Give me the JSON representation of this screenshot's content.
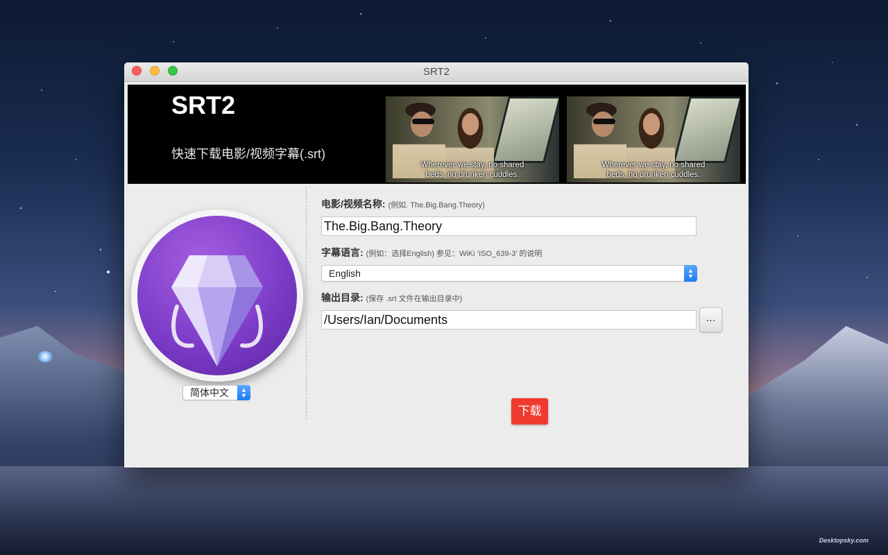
{
  "window": {
    "title": "SRT2"
  },
  "banner": {
    "title": "SRT2",
    "subtitle": "快速下载电影/视频字幕(.srt)",
    "sample_subtitle_line1": "Wherever we stay, no shared",
    "sample_subtitle_line2": "beds, no drunken cuddles."
  },
  "sidebar": {
    "ui_language": "简体中文"
  },
  "form": {
    "title_label": "电影/视频名称:",
    "title_hint": "(例如. The.Big.Bang.Theory)",
    "title_value": "The.Big.Bang.Theory",
    "language_label": "字幕语言:",
    "language_hint": "(例如：选择English) 参见：WiKi ‘ISO_639-3’ 的说明",
    "language_value": "English",
    "output_label": "输出目录:",
    "output_hint": "(保存 .srt 文件在输出目录中)",
    "output_value": "/Users/Ian/Documents",
    "browse_label": "...",
    "download_label": "下载"
  },
  "desktop": {
    "watermark": "Desktopsky.com"
  },
  "colors": {
    "accent_blue": "#1b7cf3",
    "download_red": "#ef3b2f",
    "icon_purple": "#7d3cc8",
    "traffic_close": "#fc605c",
    "traffic_minimize": "#fdbc40",
    "traffic_zoom": "#34c84a"
  },
  "icons": {
    "stepper": "chevron-up-down-icon",
    "app": "diamond-icon"
  }
}
